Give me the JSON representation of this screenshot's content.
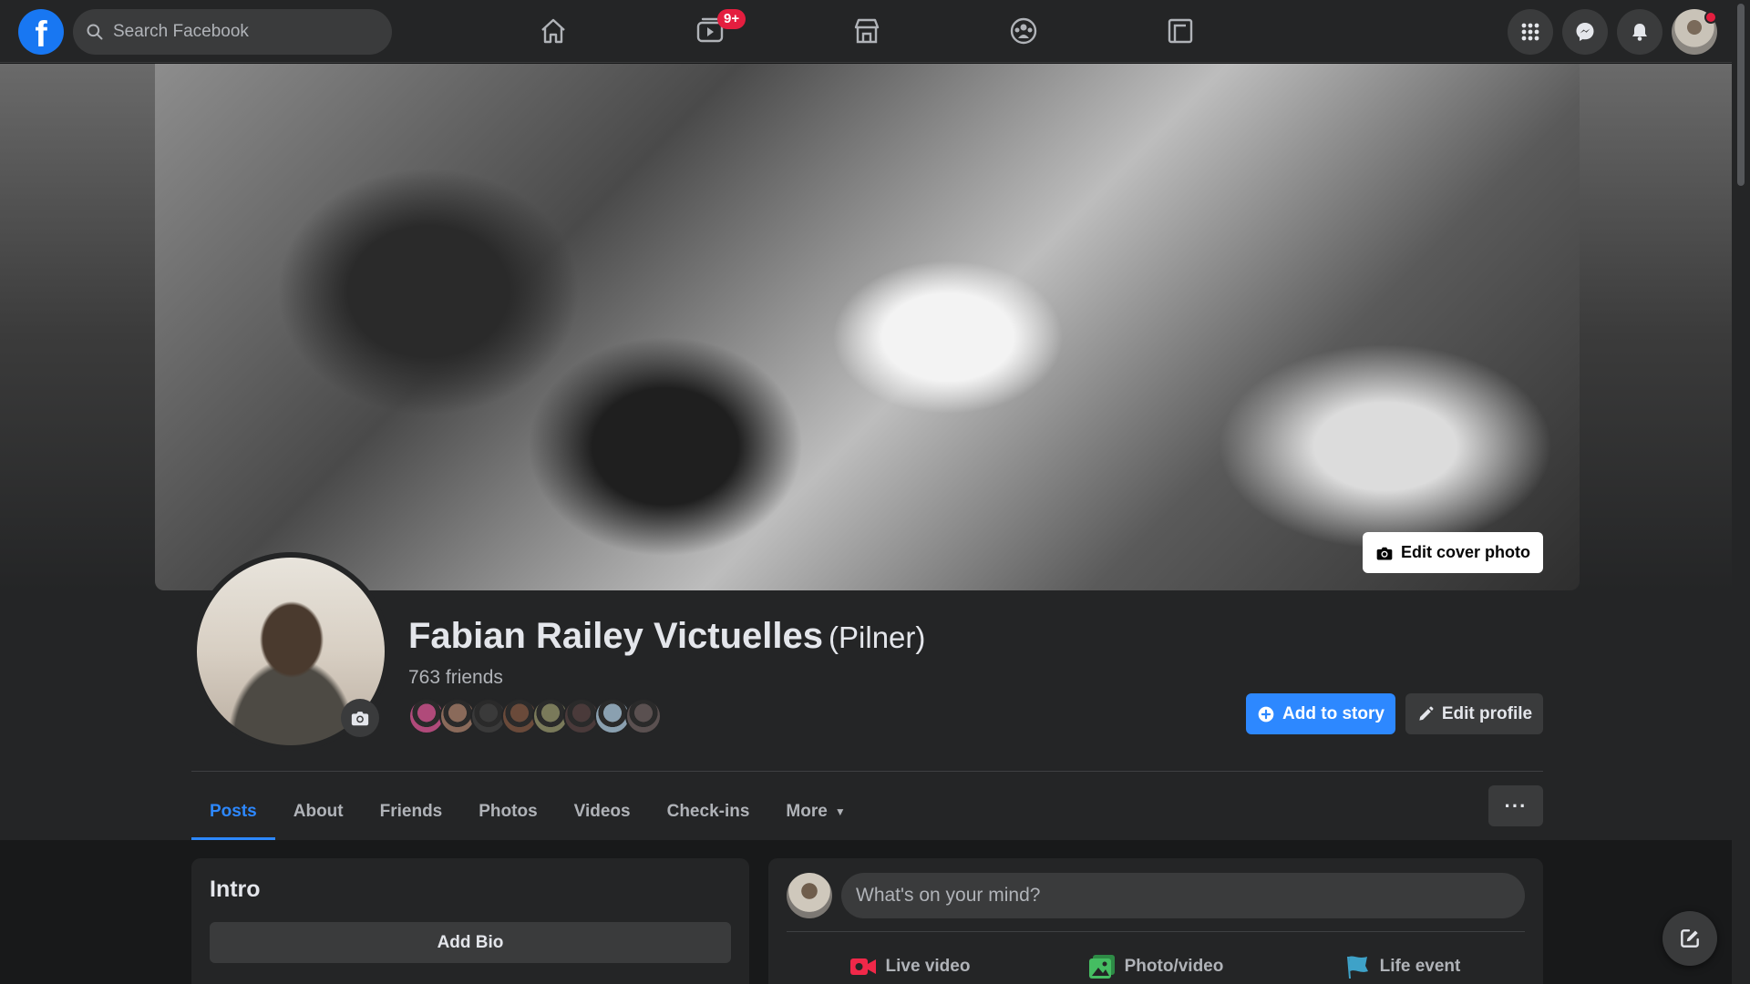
{
  "topbar": {
    "logo_letter": "f",
    "search_placeholder": "Search Facebook",
    "watch_badge": "9+",
    "nav": [
      "home-icon",
      "watch-icon",
      "marketplace-icon",
      "groups-icon",
      "gaming-icon"
    ],
    "right": [
      "menu-grid-icon",
      "messenger-icon",
      "notifications-icon"
    ]
  },
  "cover": {
    "edit_label": "Edit cover photo"
  },
  "profile": {
    "name": "Fabian Railey Victuelles",
    "nickname": "(Pilner)",
    "friends_count": "763 friends",
    "friend_avatar_colors": [
      "#b04a7a",
      "#8a6a5a",
      "#3a3a3a",
      "#6a4a3a",
      "#7a7a5a",
      "#4a3a3a",
      "#8aa0b0",
      "#5a5050"
    ],
    "add_to_story_label": "Add to story",
    "edit_profile_label": "Edit profile"
  },
  "tabs": {
    "items": [
      "Posts",
      "About",
      "Friends",
      "Photos",
      "Videos",
      "Check-ins",
      "More"
    ],
    "active": "Posts",
    "more_dots": "···"
  },
  "intro": {
    "title": "Intro",
    "add_bio_label": "Add Bio"
  },
  "composer": {
    "placeholder": "What's on your mind?",
    "actions": [
      {
        "label": "Live video",
        "icon": "live-video-icon",
        "color": "#f02849"
      },
      {
        "label": "Photo/video",
        "icon": "photo-video-icon",
        "color": "#45bd62"
      },
      {
        "label": "Life event",
        "icon": "life-event-icon",
        "color": "#3ea2c8"
      }
    ]
  },
  "colors": {
    "accent": "#2d88ff",
    "background": "#18191a",
    "surface": "#242526",
    "notification": "#e41e3f"
  }
}
